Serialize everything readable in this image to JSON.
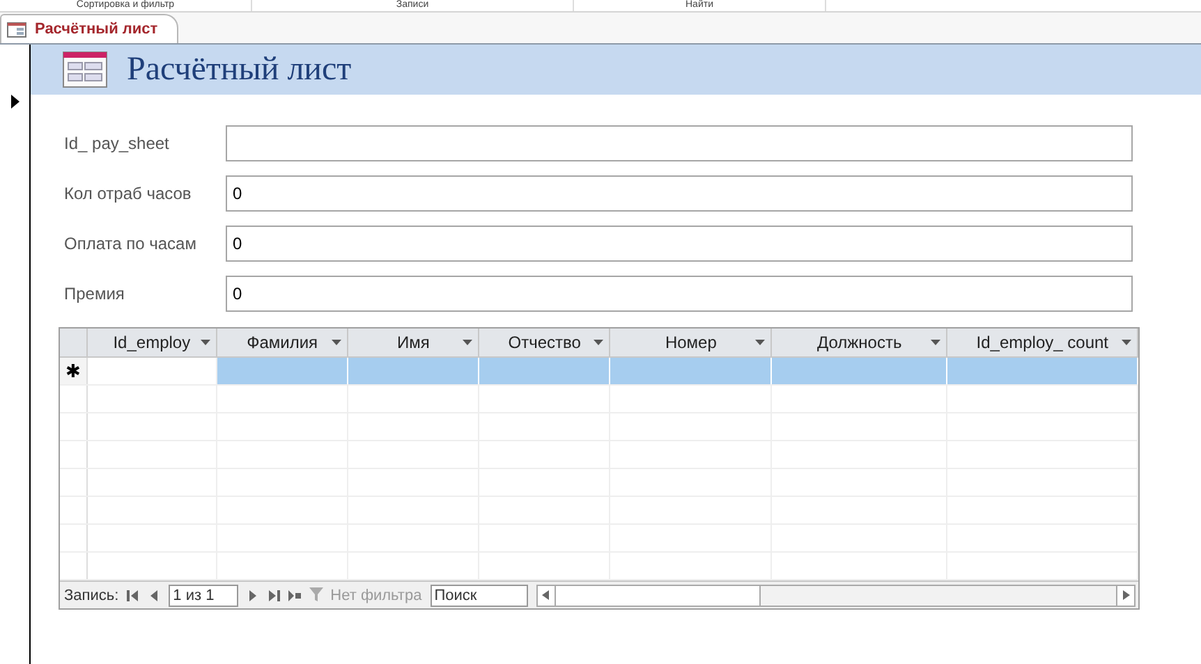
{
  "ribbon_groups": [
    "Сортировка и фильтр",
    "Записи",
    "Найти"
  ],
  "tabs": [
    {
      "label": "Расчётный лист",
      "selected": true
    }
  ],
  "form": {
    "title": "Расчётный лист",
    "fields": [
      {
        "label": "Id_ pay_sheet"
      },
      {
        "label": "Кол отраб часов",
        "value": "0"
      },
      {
        "label": "Оплата по часам",
        "value": "0"
      },
      {
        "label": "Премия",
        "value": "0"
      }
    ]
  },
  "subform": {
    "columns": [
      "Id_employ",
      "Фамилия",
      "Имя",
      "Отчество",
      "Номер",
      "Должность",
      "Id_employ_ count"
    ],
    "new_row_marker": "✱",
    "new_row_selected": true,
    "navigator": {
      "label": "Запись:",
      "position": "1 из 1",
      "filter": "Нет фильтра",
      "search_placeholder": "Поиск"
    }
  }
}
